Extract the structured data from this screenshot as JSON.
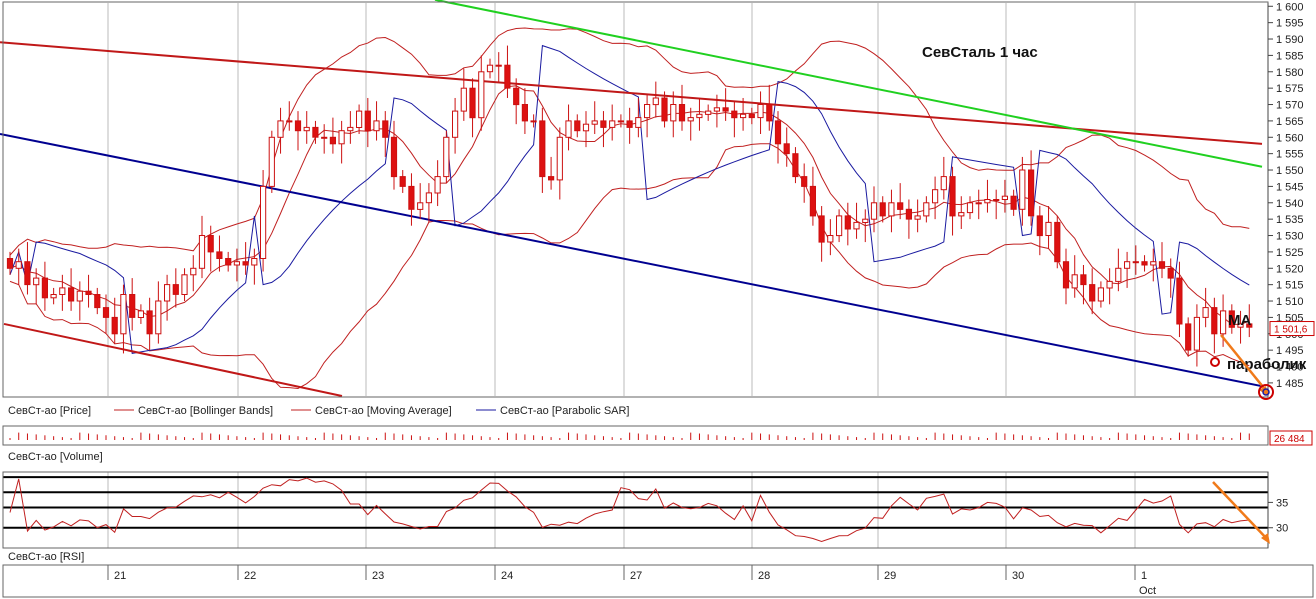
{
  "chart_data": {
    "type": "candlestick",
    "title": "СевСталь   1 час",
    "price_axis": {
      "ylim": [
        1481,
        1601
      ],
      "ticks": [
        1485,
        1490,
        1495,
        1500,
        1505,
        1510,
        1515,
        1520,
        1525,
        1530,
        1535,
        1540,
        1545,
        1550,
        1555,
        1560,
        1565,
        1570,
        1575,
        1580,
        1585,
        1590,
        1595,
        1600
      ],
      "tick_labels": [
        "1 485",
        "1 490",
        "1 495",
        "1 500",
        "1 505",
        "1 510",
        "1 515",
        "1 520",
        "1 525",
        "1 530",
        "1 535",
        "1 540",
        "1 545",
        "1 550",
        "1 555",
        "1 560",
        "1 565",
        "1 570",
        "1 575",
        "1 580",
        "1 585",
        "1 590",
        "1 595",
        "1 600"
      ],
      "last_price_tag": "1 501,6"
    },
    "time_axis": {
      "day_labels": [
        "21",
        "22",
        "23",
        "24",
        "27",
        "28",
        "29",
        "30",
        "1"
      ],
      "month_label": "Oct"
    },
    "legend": {
      "price": [
        "СевСт-ао [Price]",
        "СевСт-ао [Bollinger Bands]",
        "СевСт-ао [Moving Average]",
        "СевСт-ао [Parabolic SAR]"
      ],
      "volume": "СевСт-ао [Volume]",
      "rsi": "СевСт-ао [RSI]"
    },
    "volume_tag": "26 484",
    "rsi_axis": {
      "ylim": [
        26,
        41
      ],
      "ticks": [
        30,
        35
      ],
      "tick_labels": [
        "30",
        "35"
      ]
    },
    "close_series": [
      1520,
      1522,
      1515,
      1517,
      1511,
      1512,
      1514,
      1510,
      1513,
      1512,
      1508,
      1505,
      1500,
      1512,
      1505,
      1507,
      1500,
      1510,
      1515,
      1512,
      1518,
      1520,
      1530,
      1525,
      1523,
      1521,
      1522,
      1521,
      1523,
      1545,
      1560,
      1565,
      1565,
      1562,
      1563,
      1560,
      1560,
      1558,
      1562,
      1563,
      1568,
      1562,
      1565,
      1560,
      1548,
      1545,
      1538,
      1540,
      1543,
      1548,
      1560,
      1568,
      1575,
      1566,
      1580,
      1582,
      1582,
      1575,
      1570,
      1565,
      1565,
      1548,
      1547,
      1560,
      1565,
      1562,
      1564,
      1565,
      1563,
      1565,
      1565,
      1563,
      1566,
      1570,
      1572,
      1565,
      1570,
      1565,
      1566,
      1567,
      1568,
      1569,
      1568,
      1566,
      1567,
      1566,
      1570,
      1565,
      1558,
      1555,
      1548,
      1545,
      1536,
      1528,
      1530,
      1536,
      1532,
      1534,
      1535,
      1540,
      1536,
      1540,
      1538,
      1535,
      1536,
      1540,
      1544,
      1548,
      1536,
      1537,
      1540,
      1540,
      1541,
      1541,
      1542,
      1538,
      1550,
      1536,
      1530,
      1534,
      1522,
      1514,
      1518,
      1515,
      1510,
      1514,
      1516,
      1520,
      1522,
      1522,
      1521,
      1522,
      1520,
      1517,
      1503,
      1495,
      1505,
      1508,
      1500,
      1507,
      1502,
      1503,
      1502
    ],
    "indicators": {
      "bollinger_middle_start": 1525,
      "moving_average_type": "Moving Average",
      "parabolic_sar_last": 1493
    },
    "trend_lines": [
      {
        "color": "#c01818",
        "from_price": 1589,
        "to_price": 1558
      },
      {
        "color": "#000090",
        "from_price": 1561,
        "to_price": 1484
      },
      {
        "color": "#20d020",
        "from_price": 1602,
        "to_price": 1551
      },
      {
        "color": "#c01818",
        "from_price": 1503,
        "to_price": 1484
      }
    ],
    "annotations": [
      "MA",
      "параболик"
    ],
    "rsi_levels": [
      30,
      34,
      37
    ]
  }
}
